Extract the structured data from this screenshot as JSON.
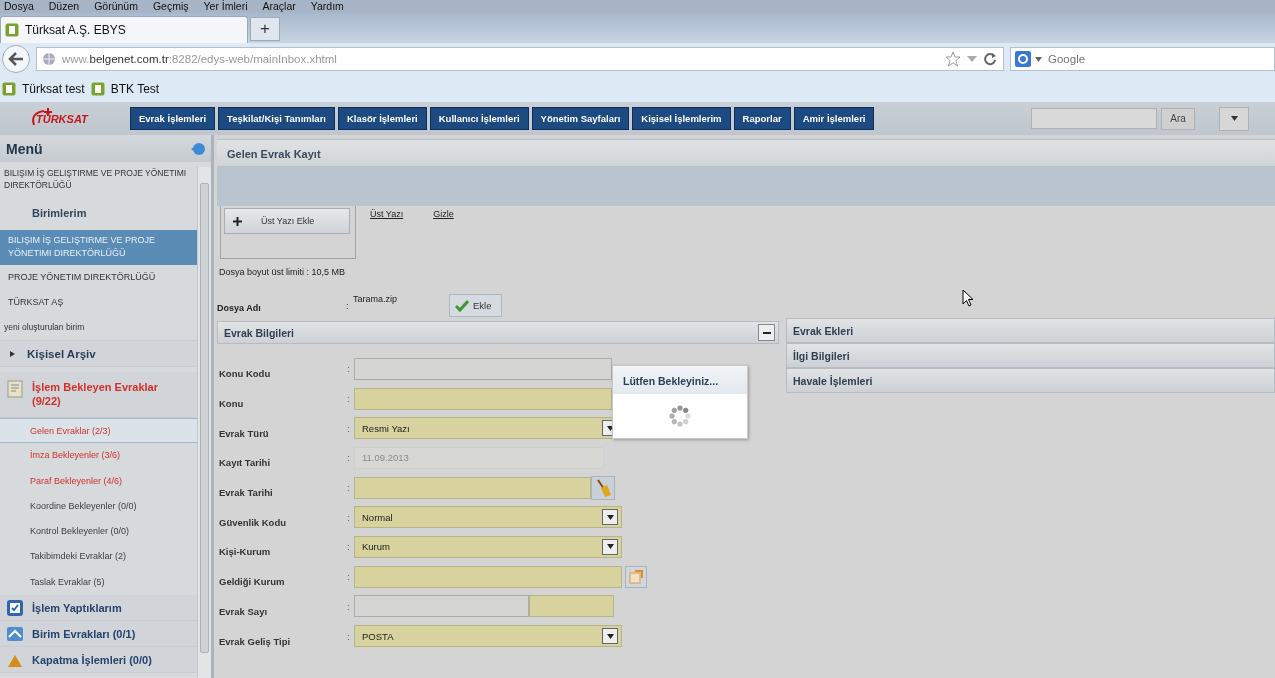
{
  "menu_bar": [
    "Dosya",
    "Düzen",
    "Görünüm",
    "Geçmiş",
    "Yer İmleri",
    "Araçlar",
    "Yardım"
  ],
  "browser_tabs": [
    {
      "title": "Türksat A.Ş. EBYS",
      "selected": true
    }
  ],
  "new_tab": "+",
  "address_bar": {
    "url": "www.**belgenet.com.tr**:8282/edys-web/mainInbox.xhtml"
  },
  "search_bar": {
    "placeholder": "Google"
  },
  "bookmarks": [
    "Türksat test",
    "BTK Test"
  ],
  "app_header": {
    "logo": "TÜRKSAT",
    "nav": [
      "Evrak İşlemleri",
      "Teşkilat/Kişi Tanımları",
      "Klasör İşlemleri",
      "Kullanıcı İşlemleri",
      "Yönetim Sayfaları",
      "Kişisel İşlemlerim",
      "Raporlar",
      "Amir İşlemleri"
    ],
    "search_button": "Ara"
  },
  "sidebar": {
    "title": "Menü",
    "items": [
      {
        "kind": "caption",
        "text": "BILIŞIM İŞ GELIŞTIRME VE PROJE YÖNETIMI DIREKTÖRLÜĞÜ"
      },
      {
        "kind": "header",
        "text": "Birimlerim"
      },
      {
        "kind": "unit",
        "text": "BILIŞIM İŞ GELIŞTIRME VE PROJE YÖNETIMI DIREKTÖRLÜĞÜ",
        "selected": true
      },
      {
        "kind": "unit",
        "text": "PROJE YÖNETIM DIREKTÖRLÜĞÜ",
        "selected": false
      },
      {
        "kind": "unit",
        "text": "TÜRKSAT AŞ",
        "selected": false
      },
      {
        "kind": "unit",
        "text": "yeni oluşturulan birim",
        "selected": false
      },
      {
        "kind": "folder",
        "text": "Kişisel Arşiv",
        "expanded": false
      },
      {
        "kind": "group",
        "text": "İşlem Bekleyen Evraklar (9/22)",
        "color": "#d3302a"
      },
      {
        "kind": "link",
        "text": "Gelen Evraklar (2/3)",
        "highlighted": true,
        "selected": true
      },
      {
        "kind": "link",
        "text": "İmza Bekleyenler (3/6)",
        "highlighted": true,
        "selected": false
      },
      {
        "kind": "link",
        "text": "Paraf Bekleyenler (4/6)",
        "highlighted": true,
        "selected": false
      },
      {
        "kind": "link",
        "text": "Koordine Bekleyenler (0/0)",
        "highlighted": false,
        "selected": false
      },
      {
        "kind": "link",
        "text": "Kontrol Bekleyenler (0/0)",
        "highlighted": false,
        "selected": false
      },
      {
        "kind": "link",
        "text": "Takibimdeki Evraklar (2)",
        "highlighted": false,
        "selected": false
      },
      {
        "kind": "link",
        "text": "Taslak Evraklar (5)",
        "highlighted": false,
        "selected": false
      },
      {
        "kind": "group",
        "text": "İşlem Yaptıklarım",
        "color": "#25436b"
      },
      {
        "kind": "group",
        "text": "Birim Evrakları (0/1)",
        "color": "#25436b"
      },
      {
        "kind": "group",
        "text": "Kapatma İşlemleri (0/0)",
        "color": "#25436b"
      }
    ]
  },
  "panel": {
    "title": "Gelen Evrak Kayıt",
    "upload": {
      "button": "Üst Yazı Ekle",
      "links": [
        "Üst Yazı",
        "Gizle"
      ],
      "limit": "Dosya boyut üst limiti : 10,5 MB",
      "file_label": "Dosya Adı",
      "colon": ":",
      "file_name": "Tarama.zip",
      "add_button": "Ekle"
    },
    "form": {
      "title": "Evrak Bilgileri",
      "expanded": true,
      "fields": [
        {
          "label": "Konu Kodu",
          "colon": ":",
          "kind": "text",
          "required": false
        },
        {
          "label": "Konu",
          "colon": ":",
          "kind": "text",
          "required": true
        },
        {
          "label": "Evrak Türü",
          "colon": ":",
          "kind": "select",
          "required": true,
          "value": "Resmi Yazı"
        },
        {
          "label": "Kayıt Tarihi",
          "colon": ":",
          "kind": "text",
          "required": false,
          "disabled": true,
          "value": "11.09.2013"
        },
        {
          "label": "Evrak Tarihi",
          "colon": ":",
          "kind": "date",
          "required": true
        },
        {
          "label": "Güvenlik Kodu",
          "colon": ":",
          "kind": "select",
          "required": true,
          "value": "Normal"
        },
        {
          "label": "Kişi-Kurum",
          "colon": ":",
          "kind": "select",
          "required": true,
          "value": "Kurum"
        },
        {
          "label": "Geldiği Kurum",
          "colon": ":",
          "kind": "lookup",
          "required": true
        },
        {
          "label": "Evrak Sayı",
          "colon": ":",
          "kind": "split",
          "required": true
        },
        {
          "label": "Evrak Geliş Tipi",
          "colon": ":",
          "kind": "select",
          "required": true,
          "value": "POSTA"
        }
      ]
    },
    "sections": [
      {
        "title": "Evrak Ekleri"
      },
      {
        "title": "İlgi Bilgileri"
      },
      {
        "title": "Havale İşlemleri"
      }
    ]
  },
  "loading": {
    "text": "Lütfen Bekleyiniz..."
  }
}
